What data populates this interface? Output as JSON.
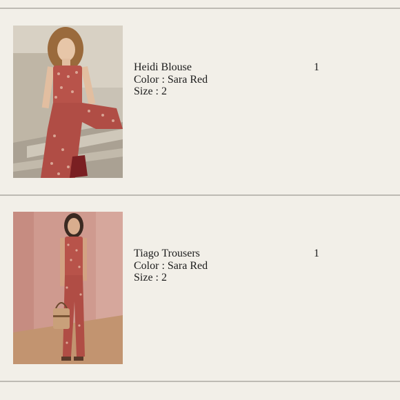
{
  "cart": {
    "items": [
      {
        "name": "Heidi Blouse",
        "color_label": "Color : Sara Red",
        "size_label": "Size : 2",
        "quantity": "1",
        "image_icon": "model-seated-on-stone-steps-photo"
      },
      {
        "name": "Tiago Trousers",
        "color_label": "Color : Sara Red",
        "size_label": "Size : 2",
        "quantity": "1",
        "image_icon": "model-standing-pink-wall-photo"
      }
    ]
  },
  "colors": {
    "background": "#f2efe8",
    "divider": "#bdbab3",
    "text": "#1b1b1b",
    "garment_red": "#b8534a"
  }
}
